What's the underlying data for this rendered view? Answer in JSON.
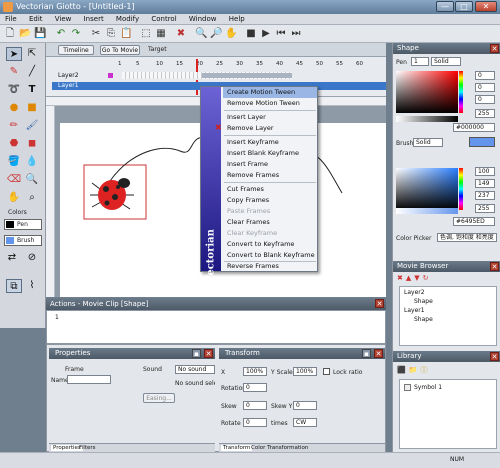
{
  "window": {
    "title": "Vectorian Giotto - [Untitled-1]",
    "min_glyph": "—",
    "max_glyph": "□",
    "close_glyph": "✕"
  },
  "menu": [
    "File",
    "Edit",
    "View",
    "Insert",
    "Modify",
    "Control",
    "Window",
    "Help"
  ],
  "timeline_bar": {
    "timeline_label": "Timeline",
    "go_to_movie_label": "Go To Movie",
    "target_label": "Target"
  },
  "timeline": {
    "ruler": [
      "1",
      "5",
      "10",
      "15",
      "20",
      "25",
      "30",
      "35",
      "40",
      "45",
      "50",
      "55",
      "60"
    ],
    "layers": [
      "Layer2",
      "Layer1"
    ]
  },
  "tools": {
    "colors_label": "Colors",
    "pen_label": "Pen",
    "brush_label": "Brush"
  },
  "context_menu": {
    "side_label": "Vectorian",
    "items": [
      {
        "label": "Create Motion Tween",
        "disabled": false
      },
      {
        "label": "Remove Motion Tween",
        "disabled": false
      },
      {
        "label": "Insert Layer",
        "disabled": false
      },
      {
        "label": "Remove Layer",
        "disabled": false
      },
      {
        "label": "Insert Keyframe",
        "disabled": false
      },
      {
        "label": "Insert Blank Keyframe",
        "disabled": false
      },
      {
        "label": "Insert Frame",
        "disabled": false
      },
      {
        "label": "Remove Frames",
        "disabled": false
      },
      {
        "label": "Cut Frames",
        "disabled": false
      },
      {
        "label": "Copy Frames",
        "disabled": false
      },
      {
        "label": "Paste Frames",
        "disabled": true
      },
      {
        "label": "Clear Frames",
        "disabled": false
      },
      {
        "label": "Clear Keyframe",
        "disabled": true
      },
      {
        "label": "Convert to Keyframe",
        "disabled": false
      },
      {
        "label": "Convert to Blank Keyframe",
        "disabled": false
      },
      {
        "label": "Reverse Frames",
        "disabled": false
      }
    ]
  },
  "actions": {
    "title": "Actions - Movie Clip [Shape]",
    "line_number": "1"
  },
  "properties": {
    "title": "Properties",
    "frame_label": "Frame",
    "name_label": "Name",
    "sound_label": "Sound",
    "sound_value": "No sound",
    "sound_selected": "No sound selects",
    "easing_label": "Easing...",
    "tab_properties": "Properties",
    "tab_filters": "Filters"
  },
  "transform": {
    "title": "Transform",
    "x_label": "X",
    "x_value": "100%",
    "yscale_label": "Y Scale",
    "yscale_value": "100%",
    "lock_ratio_label": "Lock ratio",
    "rotation_label": "Rotation",
    "rotation_value": "0",
    "skew_label": "Skew",
    "skew_value": "0",
    "skewy_label": "Skew Y",
    "skewy_value": "0",
    "rotate_label": "Rotate",
    "rotate_value": "0",
    "times_label": "times",
    "direction_value": "CW",
    "tab_transform": "Transform",
    "tab_color": "Color Transformation"
  },
  "shape_panel": {
    "title": "Shape",
    "pen_label": "Pen",
    "pen_width": "1",
    "pen_style": "Solid",
    "rgb1": [
      "0",
      "0",
      "0"
    ],
    "alpha1": "255",
    "hex1": "#000000",
    "brush_label": "Brush",
    "brush_style": "Solid",
    "rgb2": [
      "100",
      "149",
      "237"
    ],
    "alpha2": "255",
    "hex2": "#6495ED",
    "picker_label": "Color Picker",
    "picker_value": "色调, 饱和度 和亮度 - 灯"
  },
  "movie_browser": {
    "title": "Movie Browser",
    "tree": [
      "Layer2",
      "Shape",
      "Layer1",
      "Shape"
    ]
  },
  "library": {
    "title": "Library",
    "items": [
      "Symbol 1"
    ]
  },
  "status": {
    "num": "NUM"
  },
  "colors": {
    "brush_fill": "#6495ED",
    "pen": "#000000"
  }
}
